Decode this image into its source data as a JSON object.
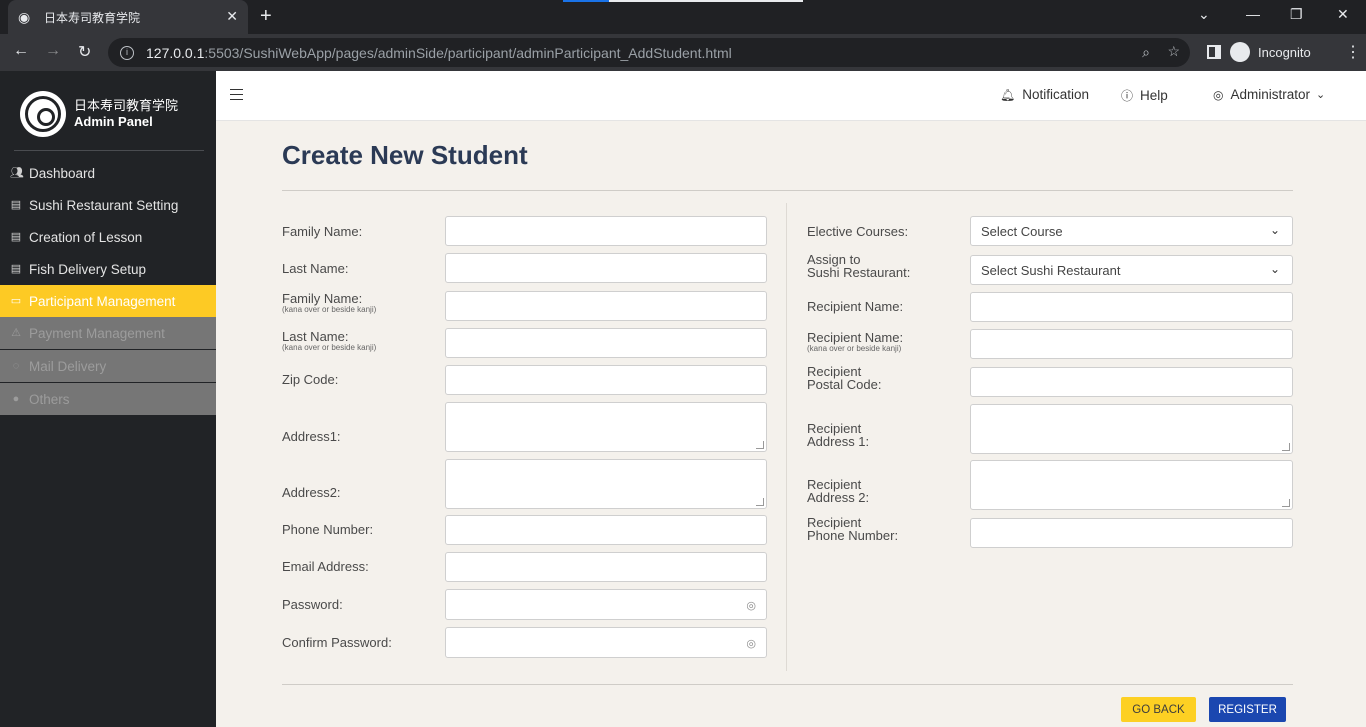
{
  "browser": {
    "tab_title": "日本寿司教育学院",
    "url_host": "127.0.0.1",
    "url_path": ":5503/SushiWebApp/pages/adminSide/participant/adminParticipant_AddStudent.html",
    "profile_label": "Incognito"
  },
  "sidebar": {
    "brand_jp": "日本寿司教育学院",
    "brand_sub": "Admin Panel",
    "items": [
      {
        "label": "Dashboard",
        "icon": "users-icon",
        "state": "normal"
      },
      {
        "label": "Sushi Restaurant Setting",
        "icon": "document-icon",
        "state": "normal"
      },
      {
        "label": "Creation of Lesson",
        "icon": "document-icon",
        "state": "normal"
      },
      {
        "label": "Fish Delivery Setup",
        "icon": "document-icon",
        "state": "normal"
      },
      {
        "label": "Participant Management",
        "icon": "card-icon",
        "state": "active"
      },
      {
        "label": "Payment Management",
        "icon": "warning-icon",
        "state": "disabled"
      },
      {
        "label": "Mail Delivery",
        "icon": "chat-icon",
        "state": "disabled"
      },
      {
        "label": "Others",
        "icon": "messenger-icon",
        "state": "disabled"
      }
    ]
  },
  "header": {
    "notification": "Notification",
    "help": "Help",
    "user": "Administrator"
  },
  "form": {
    "title": "Create New Student",
    "left": {
      "family_name": "Family Name:",
      "last_name": "Last Name:",
      "family_name_kana": "Family Name:",
      "family_name_kana_note": "(kana over or beside kanji)",
      "last_name_kana": "Last Name:",
      "last_name_kana_note": "(kana over or beside kanji)",
      "zip_code": "Zip Code:",
      "address1": "Address1:",
      "address2": "Address2:",
      "phone": "Phone Number:",
      "email": "Email Address:",
      "password": "Password:",
      "confirm_password": "Confirm Password:"
    },
    "right": {
      "elective_courses": "Elective Courses:",
      "elective_courses_value": "Select Course",
      "assign_line1": "Assign to",
      "assign_line2": "Sushi Restaurant:",
      "assign_value": "Select Sushi Restaurant",
      "recipient_name": "Recipient Name:",
      "recipient_name_kana": "Recipient Name:",
      "recipient_name_kana_note": "(kana over or beside kanji)",
      "recipient_postal_line1": "Recipient",
      "recipient_postal_line2": "Postal Code:",
      "recipient_addr1_line1": "Recipient",
      "recipient_addr1_line2": "Address 1:",
      "recipient_addr2_line1": "Recipient",
      "recipient_addr2_line2": "Address 2:",
      "recipient_phone_line1": "Recipient",
      "recipient_phone_line2": "Phone Number:"
    },
    "buttons": {
      "back": "GO BACK",
      "register": "REGISTER"
    }
  }
}
